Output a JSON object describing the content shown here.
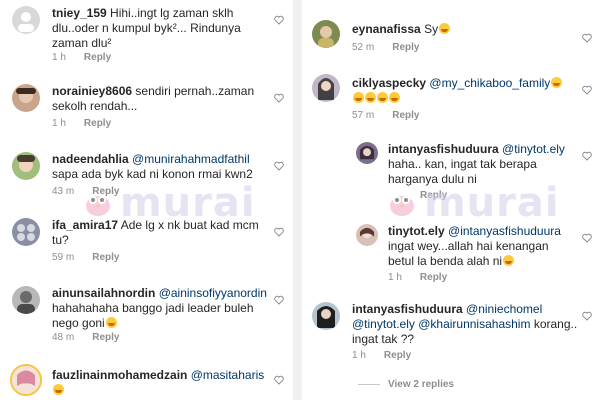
{
  "watermark": {
    "text": "murai"
  },
  "left": {
    "comments": [
      {
        "user": "tniey_159",
        "mention": "",
        "text": "Hihi..ingt lg zaman sklh dlu..oder n kumpul byk²... Rindunya zaman dlu²",
        "tail": "",
        "time": "1 h",
        "reply": "Reply",
        "avatar": "#d8d8d8"
      },
      {
        "user": "norainiey8606",
        "mention": "",
        "text": "sendiri pernah..zaman sekolh rendah...",
        "tail": "",
        "time": "1 h",
        "reply": "Reply",
        "avatar": "#c9a48c"
      },
      {
        "user": "nadeendahlia",
        "mention": "@munirahahmadfathil",
        "text": "sapa ada byk kad ni konon rmai kwn2",
        "tail": "",
        "time": "43 m",
        "reply": "Reply",
        "avatar": "#9fbf7a"
      },
      {
        "user": "ifa_amira17",
        "mention": "",
        "text": "Ade lg x nk buat kad mcm tu?",
        "tail": "",
        "time": "59 m",
        "reply": "Reply",
        "avatar": "#8a8fa6"
      },
      {
        "user": "ainunsailahnordin",
        "mention": "@aininsofiyyanordin",
        "text": "hahahahaha banggo jadi leader buleh nego goni",
        "tail": "",
        "time": "48 m",
        "reply": "Reply",
        "avatar": "#7a7a7a"
      },
      {
        "user": "fauzlinainmohamedzain",
        "mention": "@masitaharis",
        "text": "",
        "tail": "",
        "time": "",
        "reply": "",
        "avatar": "#e7b7a6"
      }
    ]
  },
  "right": {
    "comments": [
      {
        "user": "eynanafissa",
        "mention": "",
        "text": "Sy",
        "tail": "",
        "time": "52 m",
        "reply": "Reply",
        "avatar": "#7d8a52"
      },
      {
        "user": "ciklyaspecky",
        "mention": "@my_chikaboo_family",
        "text": "",
        "tail": "",
        "time": "57 m",
        "reply": "Reply",
        "avatar": "#c0b8c8"
      },
      {
        "user": "intanyasfishuduura",
        "mention": "@tinytot.ely",
        "text": "haha.. kan, ingat tak berapa harganya dulu ni",
        "tail": "",
        "time": "",
        "reply": "Reply",
        "avatar": "#7c6f8a"
      },
      {
        "user": "tinytot.ely",
        "mention": "@intanyasfishuduura",
        "text": "ingat wey...allah hai kenangan betul la benda alah ni",
        "tail": "",
        "time": "1 h",
        "reply": "Reply",
        "avatar": "#d9c1b8"
      },
      {
        "user": "intanyasfishuduura",
        "mention": "@niniechomel",
        "text": "korang.. ingat tak ??",
        "tail": "",
        "time": "1 h",
        "reply": "Reply",
        "avatar": "#b5c4cf",
        "mention2": "@tinytot.ely",
        "mention3": "@khairunnisahashim"
      }
    ],
    "view_replies": "View 2 replies"
  }
}
